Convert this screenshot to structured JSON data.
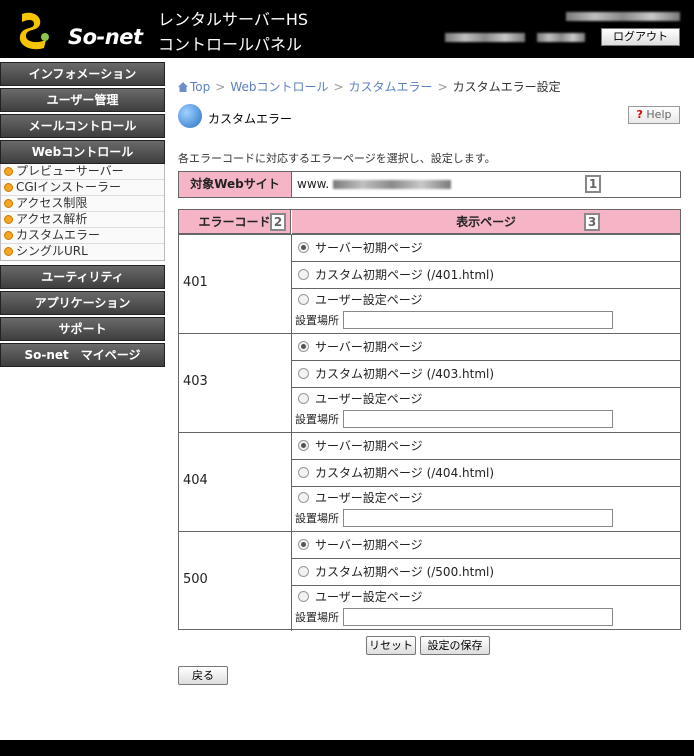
{
  "header": {
    "logo_text": "So-net",
    "title_line1": "レンタルサーバーHS",
    "title_line2": "コントロールパネル",
    "logout_label": "ログアウト"
  },
  "sidebar": {
    "items": [
      {
        "label": "インフォメーション"
      },
      {
        "label": "ユーザー管理"
      },
      {
        "label": "メールコントロール"
      },
      {
        "label": "Webコントロール"
      }
    ],
    "sub_items": [
      {
        "label": "プレビューサーバー"
      },
      {
        "label": "CGIインストーラー"
      },
      {
        "label": "アクセス制限"
      },
      {
        "label": "アクセス解析"
      },
      {
        "label": "カスタムエラー"
      },
      {
        "label": "シングルURL"
      }
    ],
    "items_after": [
      {
        "label": "ユーティリティ"
      },
      {
        "label": "アプリケーション"
      },
      {
        "label": "サポート"
      },
      {
        "label": "So-net　マイページ"
      }
    ]
  },
  "breadcrumb": {
    "top": "Top",
    "web": "Webコントロール",
    "custom": "カスタムエラー",
    "current": "カスタムエラー設定"
  },
  "page": {
    "title": "カスタムエラー",
    "help_q": "?",
    "help_label": "Help",
    "description": "各エラーコードに対応するエラーページを選択し、設定します。"
  },
  "site": {
    "label": "対象Webサイト",
    "value": "www.",
    "num": "1"
  },
  "table": {
    "col_code": "エラーコード",
    "col_code_num": "2",
    "col_page": "表示ページ",
    "col_page_num": "3",
    "opt_server": "サーバー初期ページ",
    "opt_user": "ユーザー設定ページ",
    "loc_label": "設置場所",
    "rows": [
      {
        "code": "401",
        "custom": "カスタム初期ページ (/401.html)"
      },
      {
        "code": "403",
        "custom": "カスタム初期ページ (/403.html)"
      },
      {
        "code": "404",
        "custom": "カスタム初期ページ (/404.html)"
      },
      {
        "code": "500",
        "custom": "カスタム初期ページ (/500.html)"
      }
    ]
  },
  "buttons": {
    "reset": "リセット",
    "save": "設定の保存",
    "back": "戻る"
  }
}
